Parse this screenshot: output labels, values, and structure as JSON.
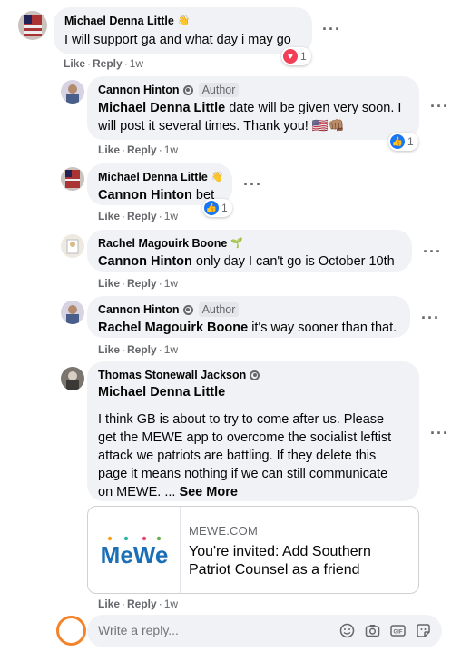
{
  "comments": [
    {
      "author": "Michael Denna Little",
      "text": "I will support ga and what day i may go",
      "like": "Like",
      "reply": "Reply",
      "time": "1w",
      "reaction_count": "1"
    },
    {
      "author": "Cannon Hinton",
      "author_tag": "Author",
      "mention": "Michael Denna Little",
      "text_line1_rest": " date will be given very soon. I",
      "text_line2": "will post it several times. Thank you! 🇺🇸👊🏽",
      "like": "Like",
      "reply": "Reply",
      "time": "1w",
      "reaction_count": "1"
    },
    {
      "author": "Michael Denna Little",
      "mention": "Cannon Hinton",
      "text": " bet",
      "like": "Like",
      "reply": "Reply",
      "time": "1w",
      "reaction_count": "1"
    },
    {
      "author": "Rachel Magouirk Boone",
      "mention": "Cannon Hinton",
      "text": " only day I can't go is October 10th",
      "like": "Like",
      "reply": "Reply",
      "time": "1w"
    },
    {
      "author": "Cannon Hinton",
      "author_tag": "Author",
      "mention": "Rachel Magouirk Boone",
      "text": " it's way sooner than that.",
      "like": "Like",
      "reply": "Reply",
      "time": "1w"
    },
    {
      "author": "Thomas Stonewall Jackson",
      "mention": "Michael Denna Little",
      "lines": [
        "I think GB is about to try to come after us. Please",
        "get the MEWE app to overcome the socialist leftist",
        "attack we patriots are battling. If they delete this",
        "page it means nothing if we can still communicate",
        "on MEWE. ... "
      ],
      "see_more": "See More",
      "like": "Like",
      "reply": "Reply",
      "time": "1w"
    }
  ],
  "link_preview": {
    "logo_text": "MeWe",
    "domain": "MEWE.COM",
    "title_line1": "You're invited: Add Southern",
    "title_line2": "Patriot Counsel as a friend"
  },
  "reply_box": {
    "placeholder": "Write a reply..."
  },
  "icons": {
    "more": "more-options-icon",
    "heart": "love-reaction-icon",
    "like": "like-reaction-icon",
    "emoji": "emoji-icon",
    "camera": "camera-icon",
    "gif": "gif-icon",
    "sticker": "sticker-icon"
  },
  "colors": {
    "bubble": "#f0f2f5",
    "like_blue": "#1877f2",
    "love_red": "#f33e58",
    "mewe_blue": "#1a6fb7",
    "avatar_ring": "#f5832a"
  }
}
